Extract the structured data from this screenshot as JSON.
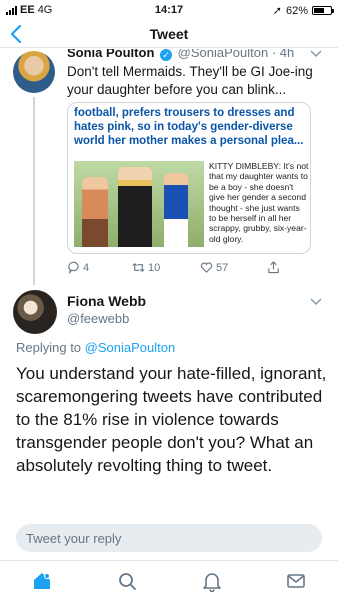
{
  "status": {
    "carrier": "EE",
    "network": "4G",
    "time": "14:17",
    "battery": "62%",
    "battery_level": 0.62
  },
  "nav": {
    "back_icon": "chevron-left-icon",
    "title": "Tweet"
  },
  "quoted_tweet": {
    "author_name": "Sonia Poulton",
    "verified_icon": "verified-badge-icon",
    "author_handle": "@SoniaPoulton",
    "age": "· 4h",
    "text": "Don't tell Mermaids. They'll be GI Joe-ing your daughter before you can blink...",
    "article": {
      "headline": "football, prefers trousers to dresses and hates pink, so in today's gender-diverse world her mother makes a personal plea...",
      "caption": "KITTY DIMBLEBY: It's not that my daughter wants to be a boy - she doesn't give her gender a second thought - she just wants to be herself in all her scrappy, grubby, six-year-old glory."
    },
    "actions": {
      "replies": "4",
      "retweets": "10",
      "likes": "57"
    }
  },
  "main_tweet": {
    "author_name": "Fiona Webb",
    "author_handle": "@feewebb",
    "replying_prefix": "Replying to ",
    "replying_to": "@SoniaPoulton",
    "text": "You understand your hate-filled, ignorant, scaremongering tweets have contributed to the 81% rise in violence towards transgender people don't you? What an absolutely revolting thing to tweet."
  },
  "reply_box": {
    "placeholder": "Tweet your reply"
  },
  "tabs": [
    {
      "icon": "home-icon",
      "label": "Home"
    },
    {
      "icon": "search-icon",
      "label": "Search"
    },
    {
      "icon": "bell-icon",
      "label": "Notifications"
    },
    {
      "icon": "mail-icon",
      "label": "Messages"
    }
  ],
  "colors": {
    "accent": "#1da1f2",
    "text": "#14171a",
    "secondary_text": "#657786",
    "headline": "#0b55a8"
  }
}
